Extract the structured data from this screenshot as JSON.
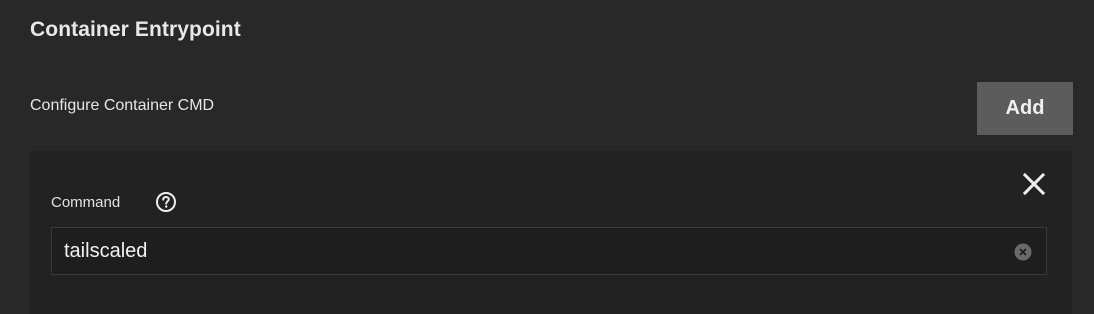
{
  "section": {
    "title": "Container Entrypoint"
  },
  "command_list": {
    "label": "Configure Container CMD",
    "add_label": "Add",
    "items": [
      {
        "field_label": "Command",
        "value": "tailscaled",
        "help_icon": "help-circle-icon",
        "clear_icon": "clear-circle-icon",
        "remove_icon": "close-icon"
      }
    ]
  },
  "colors": {
    "background": "#282828",
    "card": "#222222",
    "button": "#5c5c5c",
    "text": "#e6e6e6"
  }
}
